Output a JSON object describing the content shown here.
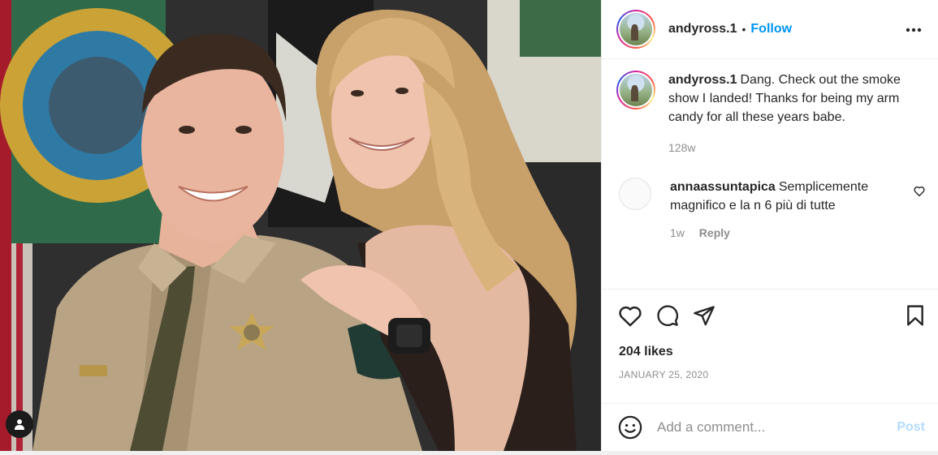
{
  "post": {
    "username": "andyross.1",
    "follow_label": "Follow",
    "separator": "•",
    "more_icon": "more-horizontal-icon",
    "tag_icon": "person-tag-icon"
  },
  "caption": {
    "username": "andyross.1",
    "text": "Dang. Check out the smoke show I landed! Thanks for being my arm candy for all these years babe.",
    "age": "128w"
  },
  "comments": [
    {
      "username": "annaassuntapica",
      "text": "Semplicemente magnifico e la n 6 più di tutte",
      "age": "1w",
      "reply_label": "Reply"
    }
  ],
  "actions": {
    "like_icon": "heart-icon",
    "comment_icon": "comment-icon",
    "share_icon": "paper-plane-icon",
    "save_icon": "bookmark-icon"
  },
  "likes": "204 likes",
  "date": "JANUARY 25, 2020",
  "add_comment": {
    "placeholder": "Add a comment...",
    "post_label": "Post",
    "emoji_icon": "smiley-icon"
  },
  "colors": {
    "accent": "#0095f6",
    "post_disabled": "#b3dbff",
    "muted": "#8e8e8e"
  }
}
